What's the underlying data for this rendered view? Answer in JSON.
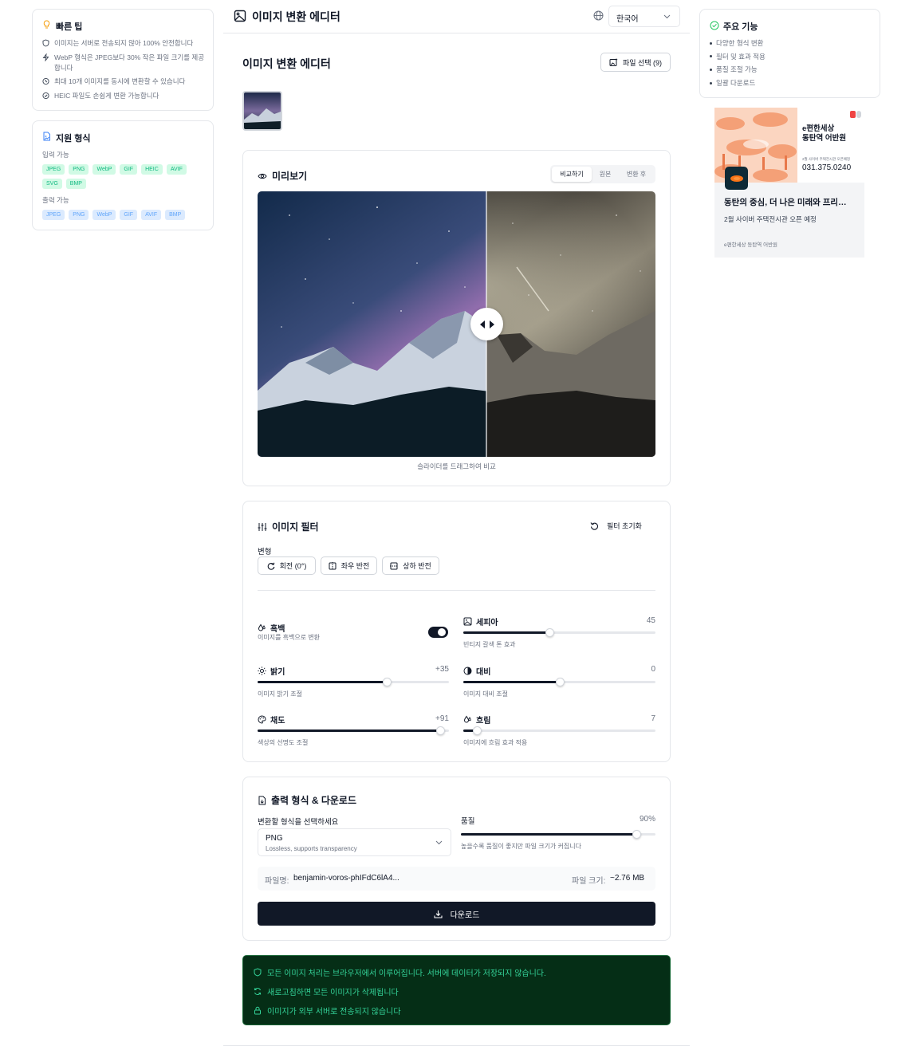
{
  "left": {
    "tips": {
      "title": "빠른 팁",
      "items": [
        "이미지는 서버로 전송되지 않아 100% 안전합니다",
        "WebP 형식은 JPEG보다 30% 작은 파일 크기를 제공합니다",
        "최대 10개 이미지를 동시에 변환할 수 있습니다",
        "HEIC 파일도 손쉽게 변환 가능합니다"
      ]
    },
    "formats": {
      "title": "지원 형식",
      "input_label": "입력 가능",
      "input": [
        "JPEG",
        "PNG",
        "WebP",
        "GIF",
        "HEIC",
        "AVIF",
        "SVG",
        "BMP"
      ],
      "output_label": "출력 가능",
      "output": [
        "JPEG",
        "PNG",
        "WebP",
        "GIF",
        "AVIF",
        "BMP"
      ]
    }
  },
  "header": {
    "title": "이미지 변환 에디터",
    "language": "한국어"
  },
  "main": {
    "title": "이미지 변환 에디터",
    "file_button": "파일 선택 (9)",
    "preview": {
      "title": "미리보기",
      "tabs": [
        "비교하기",
        "원본",
        "변환 후"
      ],
      "active_tab": 0,
      "caption": "슬라이더를 드래그하여 비교"
    },
    "filters": {
      "title": "이미지 필터",
      "reset": "필터 초기화",
      "transform_label": "변형",
      "rotate": "회전 (0°)",
      "flip_h": "좌우 반전",
      "flip_v": "상하 반전",
      "grayscale": {
        "label": "흑백",
        "desc": "이미지를 흑백으로 변환",
        "on": true
      },
      "sepia": {
        "label": "세피아",
        "value": "45",
        "desc": "빈티지 갈색 톤 효과",
        "level": 0.45
      },
      "brightness": {
        "label": "밝기",
        "value": "+35",
        "desc": "이미지 밝기 조절",
        "level": 0.675
      },
      "contrast": {
        "label": "대비",
        "value": "0",
        "desc": "이미지 대비 조절",
        "level": 0.5
      },
      "saturation": {
        "label": "채도",
        "value": "+91",
        "desc": "색상의 선명도 조절",
        "level": 0.955
      },
      "blur": {
        "label": "흐림",
        "value": "7",
        "desc": "이미지에 흐림 효과 적용",
        "level": 0.07
      }
    },
    "output": {
      "title": "출력 형식 & 다운로드",
      "format_label": "변환할 형식을 선택하세요",
      "format": "PNG",
      "format_desc": "Lossless, supports transparency",
      "quality_label": "품질",
      "quality_value": "90%",
      "quality_level": 0.9,
      "quality_desc": "높을수록 품질이 좋지만 파일 크기가 커집니다",
      "filename_label": "파일명:",
      "filename": "benjamin-voros-phIFdC6lA4...",
      "size_label": "파일 크기:",
      "size": "~2.76 MB",
      "download": "다운로드"
    },
    "notices": [
      "모든 이미지 처리는 브라우저에서 이루어집니다. 서버에 데이터가 저장되지 않습니다.",
      "새로고침하면 모든 이미지가 삭제됩니다",
      "이미지가 외부 서버로 전송되지 않습니다"
    ]
  },
  "right": {
    "features": {
      "title": "주요 기능",
      "items": [
        "다양한 형식 변환",
        "필터 및 효과 적용",
        "품질 조절 가능",
        "일괄 다운로드"
      ]
    },
    "ad": {
      "brand": "e편한세상\n동탄역 어반원",
      "tiny": "2월 사이버 주택전시관 오픈예정",
      "phone": "031.375.0240",
      "headline": "동탄의 중심, 더 나은 미래와 프리…",
      "sub": "2월 사이버 주택전시관 오픈 예정",
      "source": "e편한세상 동탄역 어반원"
    }
  },
  "colors": {
    "accent": "#111827",
    "notice_bg": "#052e16",
    "notice_text": "#34d399",
    "chip_green_bg": "#d1fae5",
    "chip_blue_bg": "#dbeafe"
  }
}
